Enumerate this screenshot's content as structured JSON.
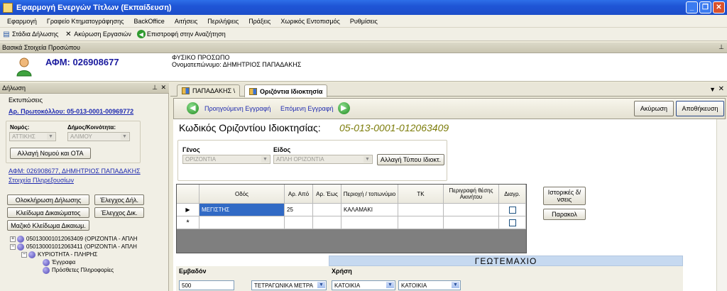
{
  "window": {
    "title": "Εφαρμογή Ενεργών Τίτλων (Εκπαίδευση)"
  },
  "menu": [
    "Εφαρμογή",
    "Γραφείο Κτηματογράφησης",
    "BackOffice",
    "Αιτήσεις",
    "Περιλήψεις",
    "Πράξεις",
    "Χωρικός Εντοπισμός",
    "Ρυθμίσεις"
  ],
  "toolbar": {
    "stadia": "Στάδια Δήλωσης",
    "akyrosi": "Ακύρωση Εργασιών",
    "epistrofi": "Επιστροφή στην Αναζήτηση"
  },
  "person": {
    "header": "Βασικά Στοιχεία Προσώπου",
    "afm": "ΑΦΜ: 026908677",
    "type": "ΦΥΣΙΚΟ ΠΡΟΣΩΠΟ",
    "name": "Ονοματεπώνυμο: ΔΗΜΗΤΡΙΟΣ ΠΑΠΑΔΑΚΗΣ"
  },
  "left": {
    "header": "Δήλωση",
    "ektyposeis": "Εκτυπώσεις",
    "protokollo": "Αρ. Πρωτοκόλλου: 05-013-0001-00969772",
    "nomos_label": "Νομός:",
    "nomos_value": "ΑΤΤΙΚΗΣ",
    "dimos_label": "Δήμος/Κοινότητα:",
    "dimos_value": "ΑΛΙΜΟΥ",
    "change_btn": "Αλλαγή Νομού και ΟΤΑ",
    "afm_link": "ΑΦΜ: 026908677, ΔΗΜΗΤΡΙΟΣ ΠΑΠΑΔΑΚΗΣ",
    "extra_link": "Στοιχεία Πληρεξουσίων",
    "btn_oloklirosi": "Ολοκλήρωση Δήλωσης",
    "btn_elegxos_dil": "Έλεγχος Δήλ.",
    "btn_kleidoma": "Κλείδωμα Δικαιώματος",
    "btn_elegxos_dik": "Έλεγχος Δικ.",
    "btn_maziko": "Μαζικό Κλείδωμα Δικαιωμ.",
    "tree": {
      "item1": "050130001012063409 (ΟΡΙΖΟΝΤΙΑ - ΑΠΛΗ",
      "item2": "050130001012063411 (ΟΡΙΖΟΝΤΙΑ - ΑΠΛΗ",
      "child": "ΚΥΡΙΟΤΗΤΑ - ΠΛΗΡΗΣ",
      "sub1": "Έγγραφα",
      "sub2": "Πρόσθετες Πληροφορίες"
    }
  },
  "tabs": {
    "tab1": "ΠΑΠΑΔΑΚΗΣ \\",
    "tab2": "Οριζόντια Ιδιοκτησία"
  },
  "nav": {
    "prev": "Προηγούμενη Εγγραφή",
    "next": "Επόμενη Εγγραφή",
    "cancel": "Ακύρωση",
    "save": "Αποθήκευση"
  },
  "form": {
    "code_label": "Κωδικός Οριζοντίου Ιδιοκτησίας:",
    "code_value": "05-013-0001-012063409",
    "genos_label": "Γένος",
    "genos_value": "ΟΡΙΖΟΝΤΙΑ",
    "eidos_label": "Είδος",
    "eidos_value": "ΑΠΛΗ ΟΡΙΖΟΝΤΙΑ",
    "change_type_btn": "Αλλαγή Τύπου Ιδιοκτ.",
    "istorikes_btn": "Ιστορικές δ/νσεις",
    "parakol_btn": "Παρακολ",
    "grid": {
      "headers": [
        "Οδός",
        "Αρ. Από",
        "Αρ. Έως",
        "Περιοχή / τοπωνύμιο",
        "ΤΚ",
        "Περιγραφή θέσης Ακινήτου",
        "Διαγρ."
      ],
      "row1": {
        "odos": "ΜΕΓΙΣΤΗΣ",
        "apo": "25",
        "eos": "",
        "periochi": "ΚΑΛΑΜΑΚΙ",
        "tk": "",
        "perigrafi": ""
      },
      "new_row_marker": "*"
    },
    "geo": {
      "title": "ΓΕΩΤΕΜΑΧΙΟ",
      "emvadon_label": "Εμβαδόν",
      "emvadon_value": "500",
      "unit": "ΤΕΤΡΑΓΩΝΙΚΑ ΜΕΤΡΑ",
      "xrisi_label": "Χρήση",
      "xrisi1": "ΚΑΤΟΙΚΙΑ",
      "xrisi2": "ΚΑΤΟΙΚΙΑ"
    }
  }
}
